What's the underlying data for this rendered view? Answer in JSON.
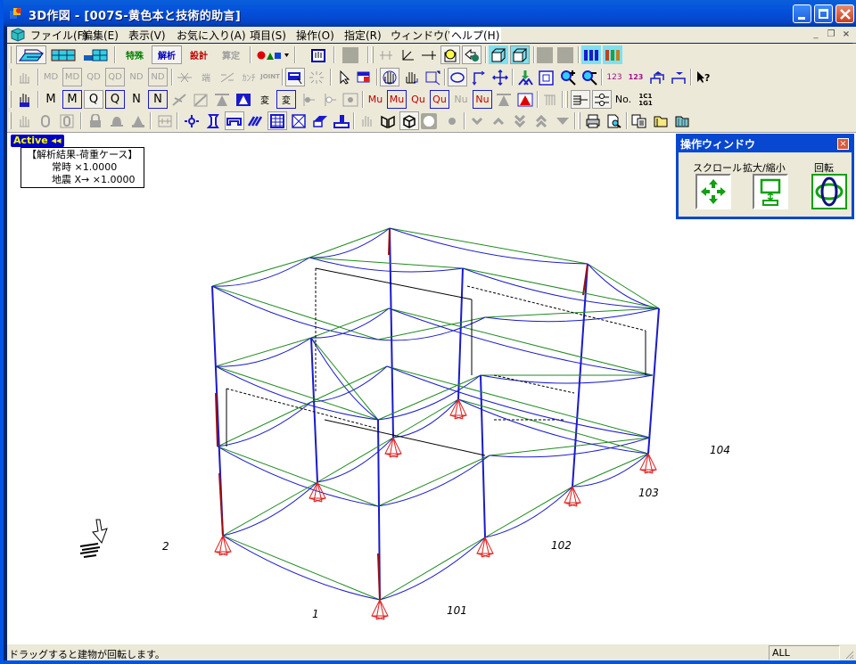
{
  "window": {
    "title": "3D作図 - [007S-黄色本と技術的助言]",
    "minimize_label": "_",
    "maximize_label": "□",
    "close_label": "×"
  },
  "menubar": {
    "items": [
      {
        "label": "ファイル(F)"
      },
      {
        "label": "編集(E)"
      },
      {
        "label": "表示(V)"
      },
      {
        "label": "お気に入り(A)"
      },
      {
        "label": "項目(S)"
      },
      {
        "label": "操作(O)"
      },
      {
        "label": "指定(R)"
      },
      {
        "label": "ウィンドウ(W)"
      },
      {
        "label": "ヘルプ(H)"
      }
    ],
    "mdi_minimize": "_",
    "mdi_restore": "❐",
    "mdi_close": "×"
  },
  "toolbar": {
    "row1": [
      "model-3d",
      "frame-grid",
      "building-elevation",
      "special",
      "analysis",
      "design",
      "check",
      "shapes",
      "view-toggle",
      "gray1",
      "joint",
      "axis",
      "dim-line",
      "light-bulb",
      "arrow-p",
      "solid-i",
      "solid-p",
      "gray2",
      "gray3",
      "columns-blue",
      "columns-color"
    ],
    "row1_labels": {
      "special": "特殊",
      "analysis": "解析",
      "design": "設計",
      "check": "算定"
    },
    "row2_labels": {
      "md1": "MD",
      "md2": "MD",
      "qd1": "QD",
      "qd2": "QD",
      "nd1": "ND",
      "nd2": "ND",
      "tan": "端",
      "kanji": "ｶﾝﾁ",
      "joint": "JOINT",
      "num1": "123",
      "num2": "123",
      "help": "?"
    },
    "row3_labels": {
      "m1": "M",
      "m2": "M",
      "q1": "Q",
      "q2": "Q",
      "n1": "N",
      "n2": "N",
      "hen1": "変",
      "hen2": "変",
      "mu1": "Mu",
      "mu2": "Mu",
      "qu1": "Qu",
      "qu2": "Qu",
      "nu1": "Nu",
      "nu2": "Nu",
      "no": "No.",
      "code": "1C1 1G1"
    }
  },
  "canvas": {
    "active_label": "Active ◂◂",
    "info": {
      "heading": "【解析結果-荷重ケース】",
      "line1": "常時 ×1.0000",
      "line2": "地震 X→ ×1.0000"
    },
    "axis_labels": [
      "1",
      "2",
      "101",
      "102",
      "103",
      "104"
    ]
  },
  "op_window": {
    "title": "操作ウィンドウ",
    "scroll_label": "スクロール",
    "zoom_label": "拡大/縮小",
    "rotate_label": "回転"
  },
  "statusbar": {
    "message": "ドラッグすると建物が回転します。",
    "pane": "ALL"
  },
  "colors": {
    "frame_blue": "#1a1acc",
    "beam_green": "#1f8a1f",
    "support_red": "#e02020",
    "column_red": "#9a1010",
    "title_blue": "#0451dc"
  }
}
